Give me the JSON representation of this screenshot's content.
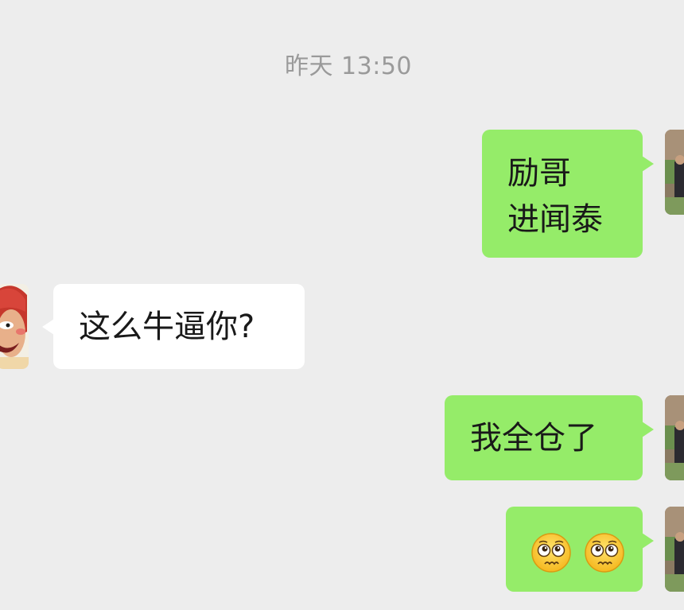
{
  "timestamp": "昨天 13:50",
  "messages": [
    {
      "side": "out",
      "lines": [
        "励哥",
        "进闻泰"
      ]
    },
    {
      "side": "in",
      "lines": [
        "这么牛逼你?"
      ]
    },
    {
      "side": "out",
      "lines": [
        "我全仓了"
      ]
    },
    {
      "side": "out",
      "emoji": [
        "pleading-face",
        "pleading-face"
      ]
    }
  ],
  "colors": {
    "background": "#ededed",
    "outgoing_bubble": "#95ec69",
    "incoming_bubble": "#ffffff",
    "timestamp_text": "#9a9a9a"
  }
}
